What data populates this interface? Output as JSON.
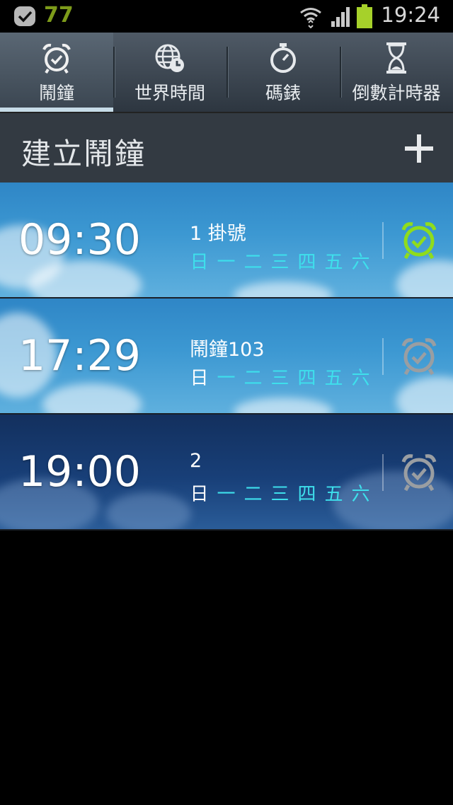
{
  "status_bar": {
    "notification_count": "77",
    "time": "19:24",
    "app_icon": "bbm-check-icon",
    "wifi_icon": "wifi-icon",
    "signal_icon": "signal-icon",
    "battery_icon": "battery-icon",
    "battery_color": "#a6d12a"
  },
  "tabs": [
    {
      "label": "鬧鐘",
      "icon": "alarm-clock-icon",
      "active": true
    },
    {
      "label": "世界時間",
      "icon": "world-clock-icon",
      "active": false
    },
    {
      "label": "碼錶",
      "icon": "stopwatch-icon",
      "active": false
    },
    {
      "label": "倒數計時器",
      "icon": "hourglass-icon",
      "active": false
    }
  ],
  "header": {
    "title": "建立鬧鐘",
    "add_icon": "plus-icon"
  },
  "alarms": [
    {
      "time": "09:30",
      "name": "1 掛號",
      "days": [
        "日",
        "一",
        "二",
        "三",
        "四",
        "五",
        "六"
      ],
      "days_active": [
        true,
        true,
        true,
        true,
        true,
        true,
        true
      ],
      "enabled": true,
      "theme": "day"
    },
    {
      "time": "17:29",
      "name": "鬧鐘103",
      "days": [
        "日",
        "一",
        "二",
        "三",
        "四",
        "五",
        "六"
      ],
      "days_active": [
        false,
        true,
        true,
        true,
        true,
        true,
        true
      ],
      "enabled": false,
      "theme": "day"
    },
    {
      "time": "19:00",
      "name": "2",
      "days": [
        "日",
        "一",
        "二",
        "三",
        "四",
        "五",
        "六"
      ],
      "days_active": [
        false,
        true,
        true,
        true,
        true,
        true,
        true
      ],
      "enabled": false,
      "theme": "night"
    }
  ],
  "colors": {
    "active_day": "#3ee0ec",
    "inactive_day": "#ffffff",
    "alarm_on": "#8fdc1c",
    "alarm_off": "#9a9ea2"
  }
}
